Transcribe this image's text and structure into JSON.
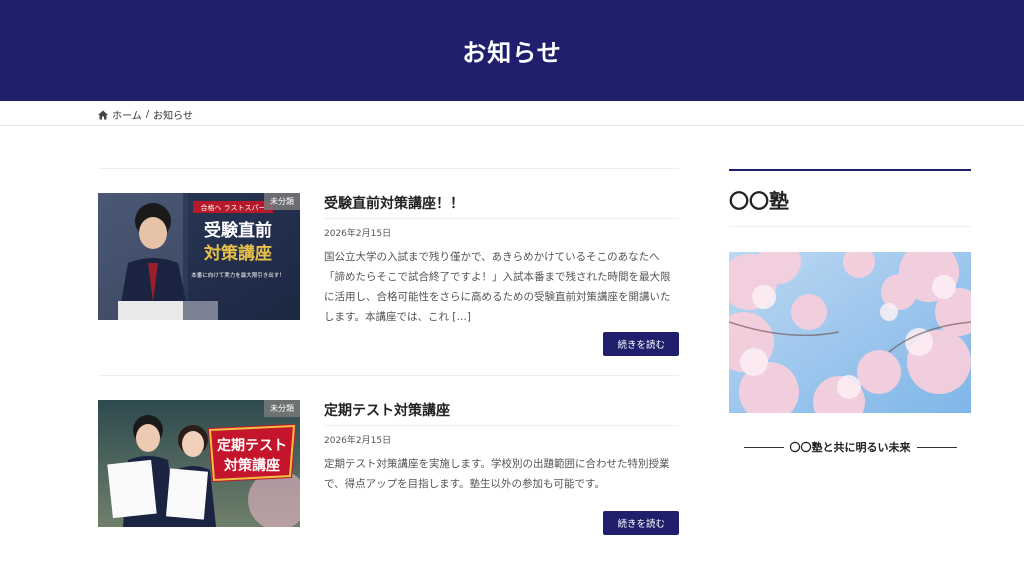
{
  "header": {
    "title": "お知らせ"
  },
  "breadcrumb": {
    "home": "ホーム",
    "separator": "/",
    "current": "お知らせ"
  },
  "posts": [
    {
      "category": "未分類",
      "title": "受験直前対策講座！！",
      "date": "2026年2月15日",
      "excerpt": "国公立大学の入試まで残り僅かで、あきらめかけているそこのあなたへ「諦めたらそこで試合終了ですよ！」入試本番まで残された時間を最大限に活用し、合格可能性をさらに高めるための受験直前対策講座を開講いたします。本講座では、これ […]",
      "read_more": "続きを読む",
      "thumb": {
        "banner": "合格へ ラストスパー",
        "line1": "受験直前",
        "line2": "対策講座",
        "tagline": "本番に向けて実力を最大限引き出す！"
      }
    },
    {
      "category": "未分類",
      "title": "定期テスト対策講座",
      "date": "2026年2月15日",
      "excerpt": "定期テスト対策講座を実施します。学校別の出題範囲に合わせた特別授業で、得点アップを目指します。塾生以外の参加も可能です。",
      "read_more": "続きを読む",
      "thumb": {
        "line1": "定期テスト",
        "line2": "対策講座"
      }
    }
  ],
  "sidebar": {
    "title": "〇〇塾",
    "caption": "〇〇塾と共に明るい未来"
  },
  "colors": {
    "brand": "#1f1f6e"
  }
}
